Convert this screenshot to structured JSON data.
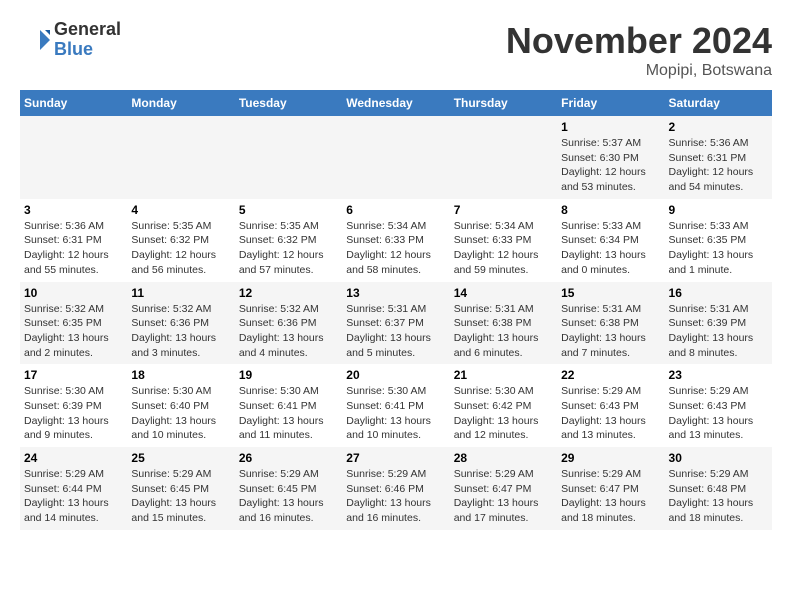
{
  "logo": {
    "general": "General",
    "blue": "Blue"
  },
  "title": "November 2024",
  "location": "Mopipi, Botswana",
  "weekdays": [
    "Sunday",
    "Monday",
    "Tuesday",
    "Wednesday",
    "Thursday",
    "Friday",
    "Saturday"
  ],
  "weeks": [
    [
      {
        "day": "",
        "info": ""
      },
      {
        "day": "",
        "info": ""
      },
      {
        "day": "",
        "info": ""
      },
      {
        "day": "",
        "info": ""
      },
      {
        "day": "",
        "info": ""
      },
      {
        "day": "1",
        "info": "Sunrise: 5:37 AM\nSunset: 6:30 PM\nDaylight: 12 hours and 53 minutes."
      },
      {
        "day": "2",
        "info": "Sunrise: 5:36 AM\nSunset: 6:31 PM\nDaylight: 12 hours and 54 minutes."
      }
    ],
    [
      {
        "day": "3",
        "info": "Sunrise: 5:36 AM\nSunset: 6:31 PM\nDaylight: 12 hours and 55 minutes."
      },
      {
        "day": "4",
        "info": "Sunrise: 5:35 AM\nSunset: 6:32 PM\nDaylight: 12 hours and 56 minutes."
      },
      {
        "day": "5",
        "info": "Sunrise: 5:35 AM\nSunset: 6:32 PM\nDaylight: 12 hours and 57 minutes."
      },
      {
        "day": "6",
        "info": "Sunrise: 5:34 AM\nSunset: 6:33 PM\nDaylight: 12 hours and 58 minutes."
      },
      {
        "day": "7",
        "info": "Sunrise: 5:34 AM\nSunset: 6:33 PM\nDaylight: 12 hours and 59 minutes."
      },
      {
        "day": "8",
        "info": "Sunrise: 5:33 AM\nSunset: 6:34 PM\nDaylight: 13 hours and 0 minutes."
      },
      {
        "day": "9",
        "info": "Sunrise: 5:33 AM\nSunset: 6:35 PM\nDaylight: 13 hours and 1 minute."
      }
    ],
    [
      {
        "day": "10",
        "info": "Sunrise: 5:32 AM\nSunset: 6:35 PM\nDaylight: 13 hours and 2 minutes."
      },
      {
        "day": "11",
        "info": "Sunrise: 5:32 AM\nSunset: 6:36 PM\nDaylight: 13 hours and 3 minutes."
      },
      {
        "day": "12",
        "info": "Sunrise: 5:32 AM\nSunset: 6:36 PM\nDaylight: 13 hours and 4 minutes."
      },
      {
        "day": "13",
        "info": "Sunrise: 5:31 AM\nSunset: 6:37 PM\nDaylight: 13 hours and 5 minutes."
      },
      {
        "day": "14",
        "info": "Sunrise: 5:31 AM\nSunset: 6:38 PM\nDaylight: 13 hours and 6 minutes."
      },
      {
        "day": "15",
        "info": "Sunrise: 5:31 AM\nSunset: 6:38 PM\nDaylight: 13 hours and 7 minutes."
      },
      {
        "day": "16",
        "info": "Sunrise: 5:31 AM\nSunset: 6:39 PM\nDaylight: 13 hours and 8 minutes."
      }
    ],
    [
      {
        "day": "17",
        "info": "Sunrise: 5:30 AM\nSunset: 6:39 PM\nDaylight: 13 hours and 9 minutes."
      },
      {
        "day": "18",
        "info": "Sunrise: 5:30 AM\nSunset: 6:40 PM\nDaylight: 13 hours and 10 minutes."
      },
      {
        "day": "19",
        "info": "Sunrise: 5:30 AM\nSunset: 6:41 PM\nDaylight: 13 hours and 11 minutes."
      },
      {
        "day": "20",
        "info": "Sunrise: 5:30 AM\nSunset: 6:41 PM\nDaylight: 13 hours and 10 minutes."
      },
      {
        "day": "21",
        "info": "Sunrise: 5:30 AM\nSunset: 6:42 PM\nDaylight: 13 hours and 12 minutes."
      },
      {
        "day": "22",
        "info": "Sunrise: 5:29 AM\nSunset: 6:43 PM\nDaylight: 13 hours and 13 minutes."
      },
      {
        "day": "23",
        "info": "Sunrise: 5:29 AM\nSunset: 6:43 PM\nDaylight: 13 hours and 13 minutes."
      }
    ],
    [
      {
        "day": "24",
        "info": "Sunrise: 5:29 AM\nSunset: 6:44 PM\nDaylight: 13 hours and 14 minutes."
      },
      {
        "day": "25",
        "info": "Sunrise: 5:29 AM\nSunset: 6:45 PM\nDaylight: 13 hours and 15 minutes."
      },
      {
        "day": "26",
        "info": "Sunrise: 5:29 AM\nSunset: 6:45 PM\nDaylight: 13 hours and 16 minutes."
      },
      {
        "day": "27",
        "info": "Sunrise: 5:29 AM\nSunset: 6:46 PM\nDaylight: 13 hours and 16 minutes."
      },
      {
        "day": "28",
        "info": "Sunrise: 5:29 AM\nSunset: 6:47 PM\nDaylight: 13 hours and 17 minutes."
      },
      {
        "day": "29",
        "info": "Sunrise: 5:29 AM\nSunset: 6:47 PM\nDaylight: 13 hours and 18 minutes."
      },
      {
        "day": "30",
        "info": "Sunrise: 5:29 AM\nSunset: 6:48 PM\nDaylight: 13 hours and 18 minutes."
      }
    ]
  ]
}
